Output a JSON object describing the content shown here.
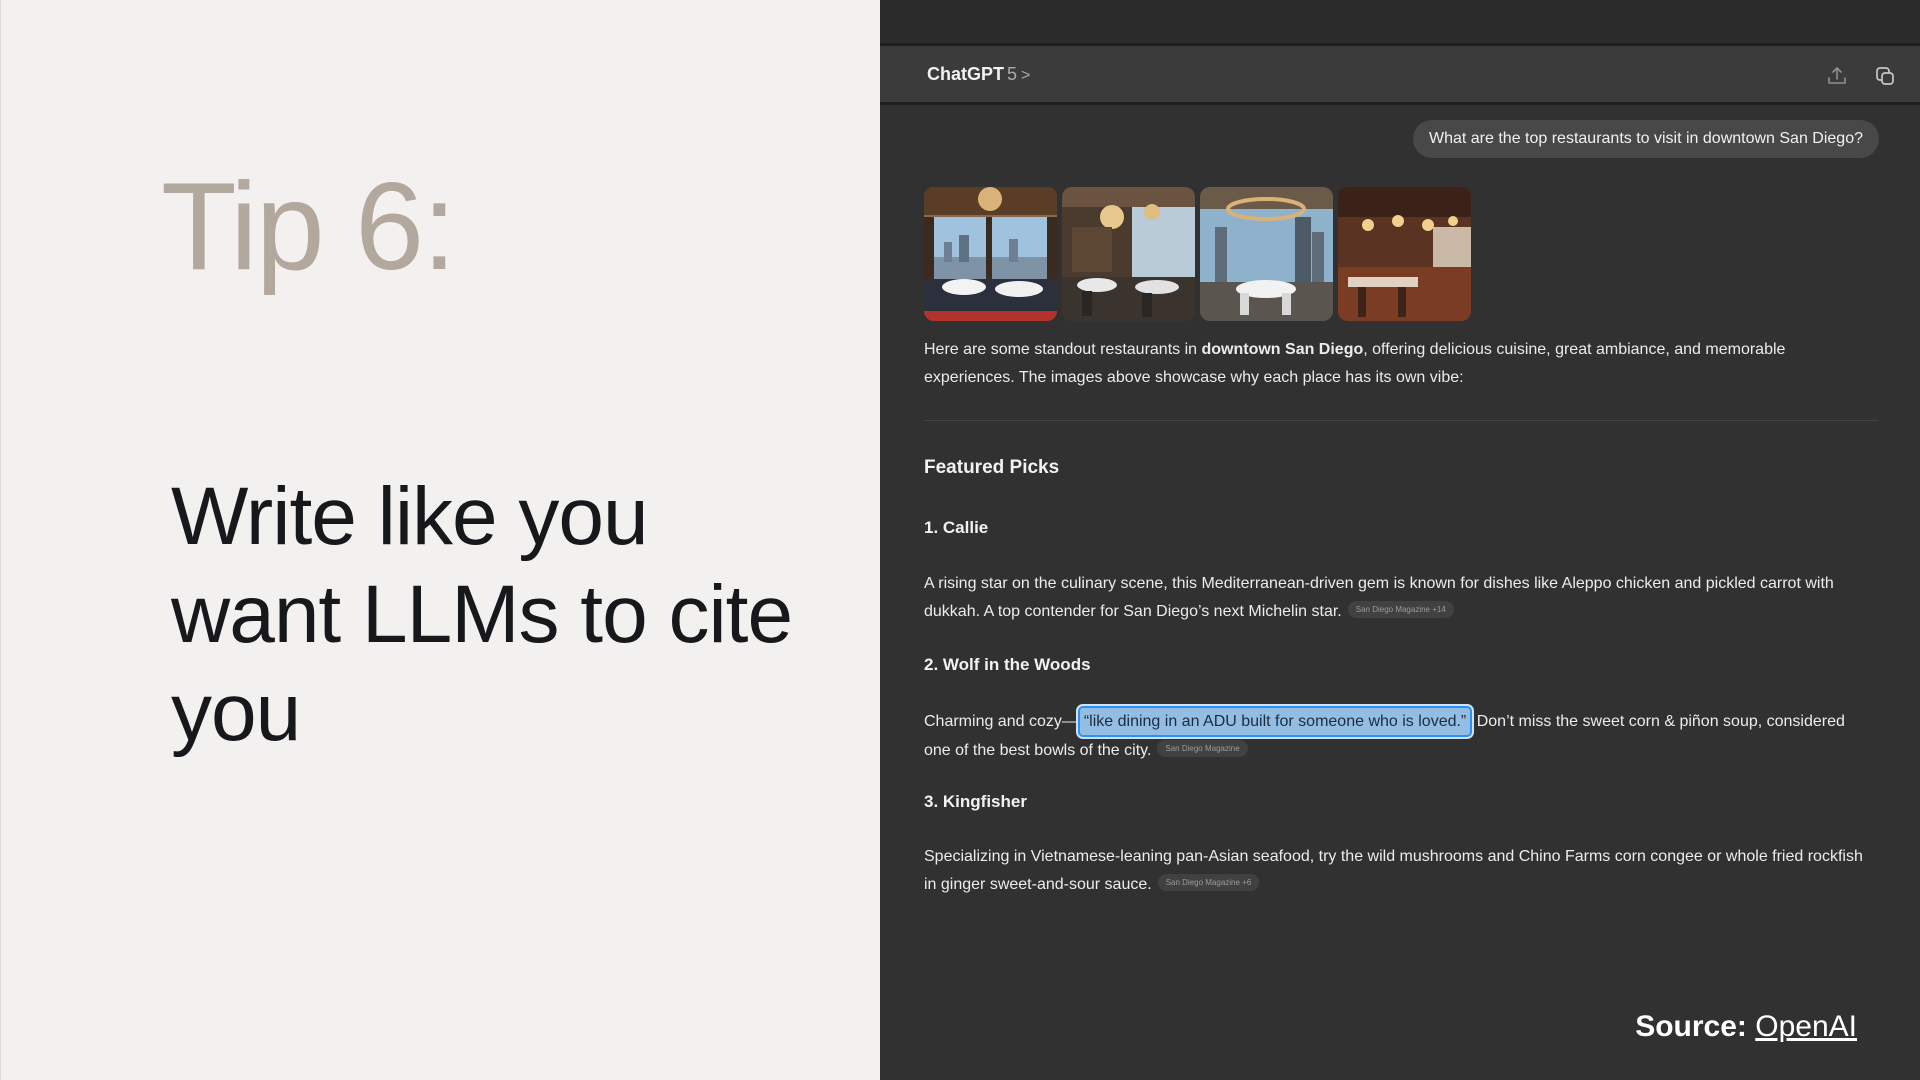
{
  "slide": {
    "tip_label": "Tip 6:",
    "headline": "Write like you want LLMs to cite you",
    "source_label": "Source:",
    "source_link": "OpenAI"
  },
  "chat": {
    "model_name": "ChatGPT",
    "model_version": "5",
    "model_chevron": ">",
    "toolbar_icons": [
      "share-icon",
      "new-chat-icon"
    ],
    "user_message": "What are the top restaurants to visit in downtown San Diego?",
    "images": [
      {
        "name": "restaurant-image-1"
      },
      {
        "name": "restaurant-image-2"
      },
      {
        "name": "restaurant-image-3"
      },
      {
        "name": "restaurant-image-4"
      }
    ],
    "intro_pre": "Here are some standout restaurants in ",
    "intro_bold": "downtown San Diego",
    "intro_post": ", offering delicious cuisine, great ambiance, and memorable experiences. The images above showcase why each place has its own vibe:",
    "section_title": "Featured Picks",
    "picks": [
      {
        "title": "1. Callie",
        "text": "A rising star on the culinary scene, this Mediterranean-driven gem is known for dishes like Aleppo chicken and pickled carrot with dukkah. A top contender for San Diego’s next Michelin star.",
        "citation": "San Diego Magazine +14"
      },
      {
        "title": "2. Wolf in the Woods",
        "text_pre": "Charming and cozy—",
        "text_highlight": "“like dining in an ADU built for someone who is loved.”",
        "text_post": " Don’t miss the sweet corn & piñon soup, considered one of the best bowls of the city.",
        "citation": "San Diego Magazine"
      },
      {
        "title": "3. Kingfisher",
        "text": "Specializing in Vietnamese-leaning pan-Asian seafood, try the wild mushrooms and Chino Farms corn congee or whole fried rockfish in ginger sweet-and-sour sauce.",
        "citation": "San Diego Magazine +6"
      }
    ]
  },
  "colors": {
    "left_bg": "#f3f1ef",
    "tip_color": "#b3a89d",
    "headline_color": "#16181b",
    "chat_bg": "#313131",
    "highlight_bg": "#94bde3",
    "highlight_border": "#2f8ff4"
  }
}
